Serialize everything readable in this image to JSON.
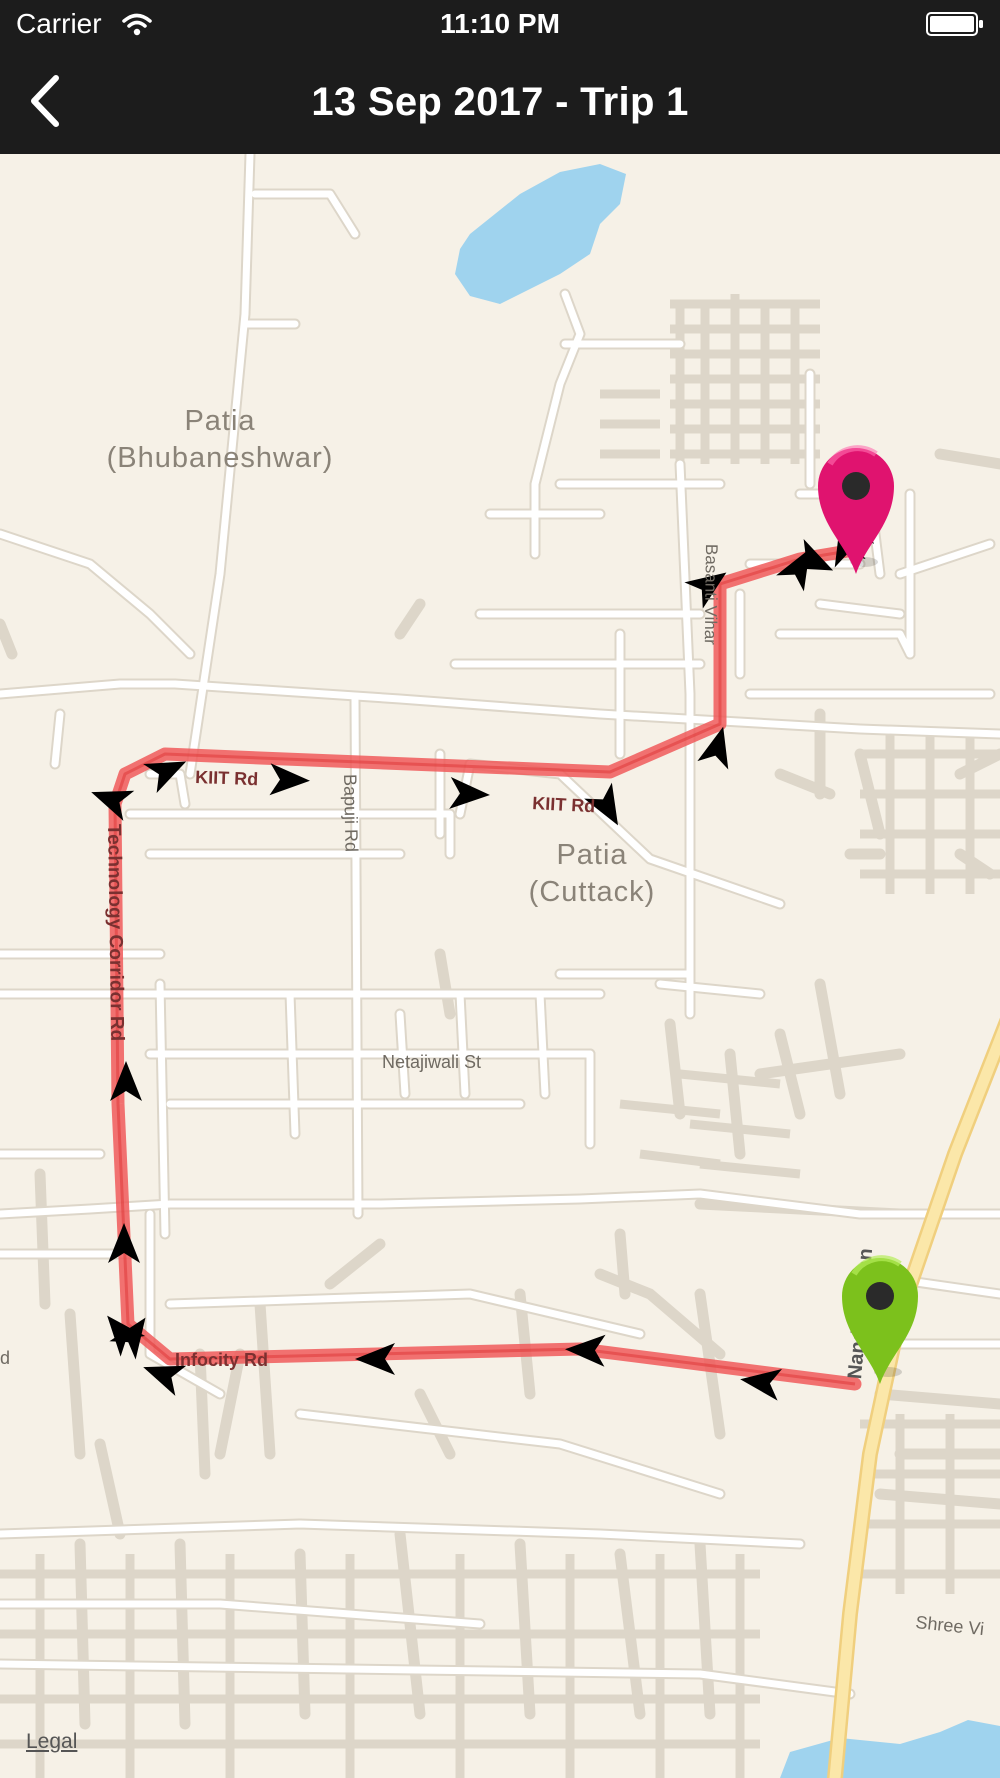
{
  "status_bar": {
    "carrier": "Carrier",
    "time": "11:10 PM",
    "wifi_icon": "wifi-icon",
    "battery_icon": "battery-icon"
  },
  "nav": {
    "back_icon": "chevron-left-icon",
    "title": "13 Sep 2017 - Trip 1"
  },
  "map": {
    "area_labels": {
      "patia_bhubaneshwar_line1": "Patia",
      "patia_bhubaneshwar_line2": "(Bhubaneshwar)",
      "patia_cuttack_line1": "Patia",
      "patia_cuttack_line2": "(Cuttack)"
    },
    "road_labels": {
      "kiit_rd_1": "KIIT Rd",
      "kiit_rd_2": "KIIT Rd",
      "bapuji_rd": "Bapuji Rd",
      "netajiwali_st": "Netajiwali St",
      "technology_corridor_rd": "Technology Corridor Rd",
      "infocity_rd": "Infocity Rd",
      "basanti_vihar": "Basanti Vihar",
      "nandankanan": "Nandankanan",
      "shree_vi": "Shree Vi",
      "edge_d": "d"
    },
    "legal": "Legal",
    "start_marker": {
      "icon": "green-pin-icon",
      "color": "#7cc11c"
    },
    "end_marker": {
      "icon": "magenta-pin-icon",
      "color": "#e0136f"
    },
    "route": {
      "color": "#f05a5a",
      "arrow_color": "#000000"
    },
    "colors": {
      "land": "#f6f1e7",
      "road": "#ffffff",
      "road_edge": "#ddd6c9",
      "water": "#9fd3ee",
      "highway": "#fbe7a9"
    }
  }
}
